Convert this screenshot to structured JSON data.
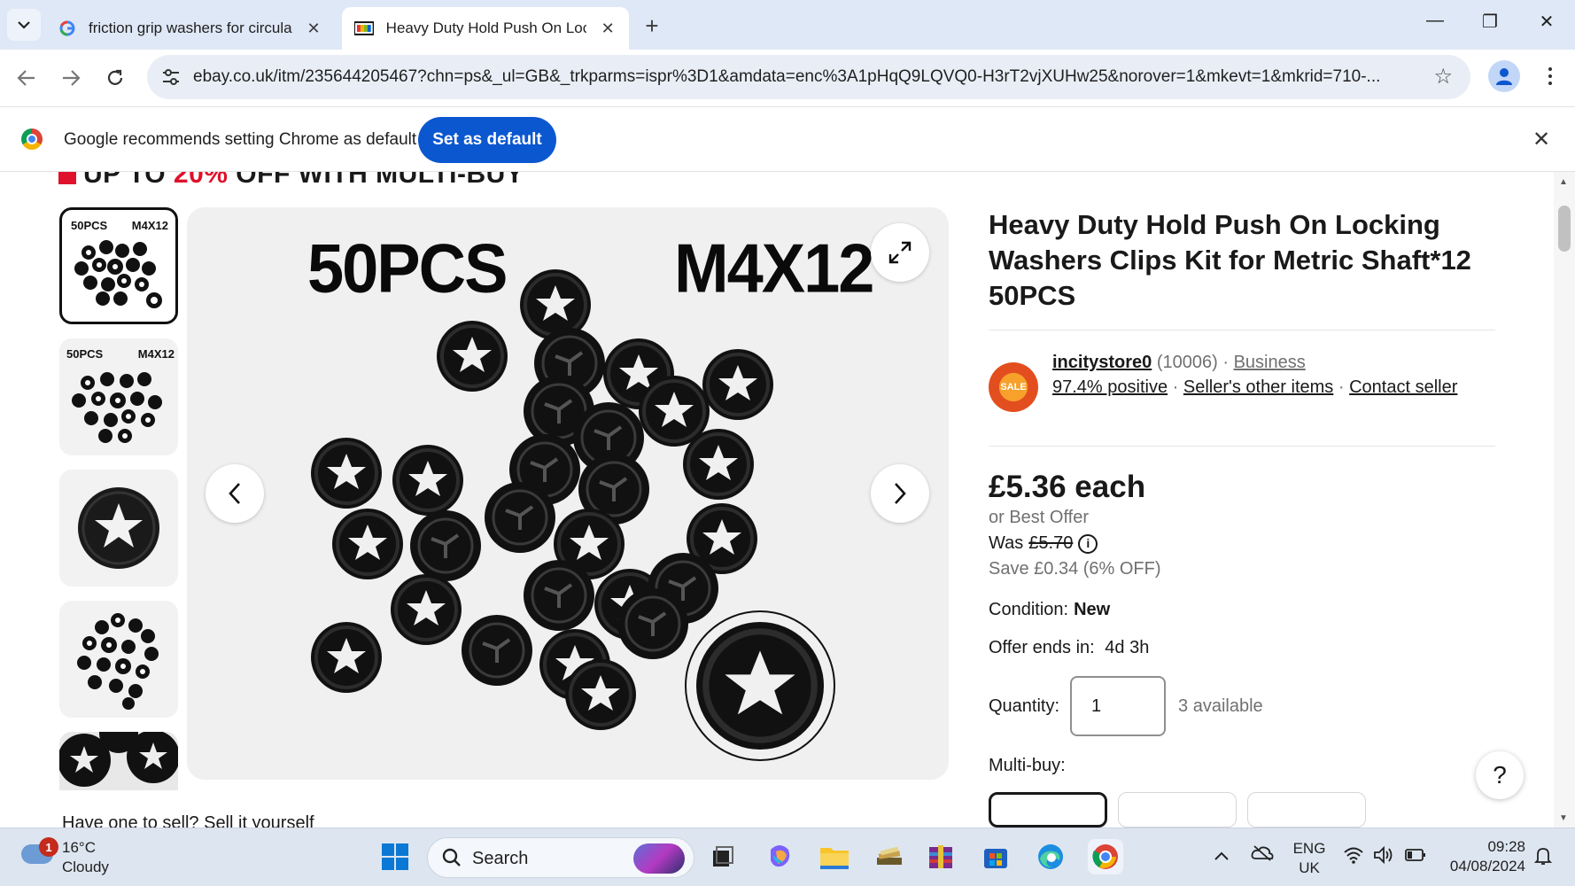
{
  "browser": {
    "tabs": [
      {
        "title": "friction grip washers for circular",
        "icon": "google-g-icon",
        "active": false
      },
      {
        "title": "Heavy Duty Hold Push On Locki",
        "icon": "ebay-flag-icon",
        "active": true
      }
    ],
    "new_tab_label": "+",
    "url": "ebay.co.uk/itm/235644205467?chn=ps&_ul=GB&_trkparms=ispr%3D1&amdata=enc%3A1pHqQ9LQVQ0-H3rT2vjXUHw25&norover=1&mkevt=1&mkrid=710-...",
    "colors": {
      "accent": "#0b57d0",
      "tabstrip": "#dfe8f6"
    }
  },
  "infobar": {
    "message": "Google recommends setting Chrome as default",
    "button": "Set as default"
  },
  "page": {
    "promo": {
      "prefix": "UP TO ",
      "percent": "20%",
      "suffix": " OFF WITH MULTI-BUY"
    },
    "thumbnails": [
      {
        "left": "50PCS",
        "right": "M4X12",
        "selected": true
      },
      {
        "left": "50PCS",
        "right": "M4X12",
        "selected": false
      },
      {
        "left": "",
        "right": "",
        "selected": false
      },
      {
        "left": "",
        "right": "",
        "selected": false
      },
      {
        "left": "",
        "right": "",
        "selected": false
      }
    ],
    "hero": {
      "label_left": "50PCS",
      "label_right": "M4X12"
    },
    "title": "Heavy Duty Hold Push On Locking Washers Clips Kit for Metric Shaft*12 50PCS",
    "seller": {
      "logo_text": "SALE",
      "name": "incitystore0",
      "feedback_count": "(10006)",
      "separator": "·",
      "business": "Business",
      "positive": "97.4% positive",
      "other_items": "Seller's other items",
      "contact": "Contact seller"
    },
    "price": "£5.36 each",
    "best_offer": "or Best Offer",
    "was_label": "Was",
    "was_price": "£5.70",
    "save": "Save £0.34 (6% OFF)",
    "condition_label": "Condition:",
    "condition_value": "New",
    "offer_label": "Offer ends in:",
    "offer_value": "4d 3h",
    "quantity_label": "Quantity:",
    "quantity_value": "1",
    "available": "3 available",
    "multibuy_label": "Multi-buy:",
    "help": "?",
    "bottom_text": "Have one to sell? Sell it yourself"
  },
  "taskbar": {
    "weather_temp": "16°C",
    "weather_desc": "Cloudy",
    "weather_badge": "1",
    "search_label": "Search",
    "lang": "ENG",
    "region": "UK",
    "time": "09:28",
    "date": "04/08/2024"
  }
}
